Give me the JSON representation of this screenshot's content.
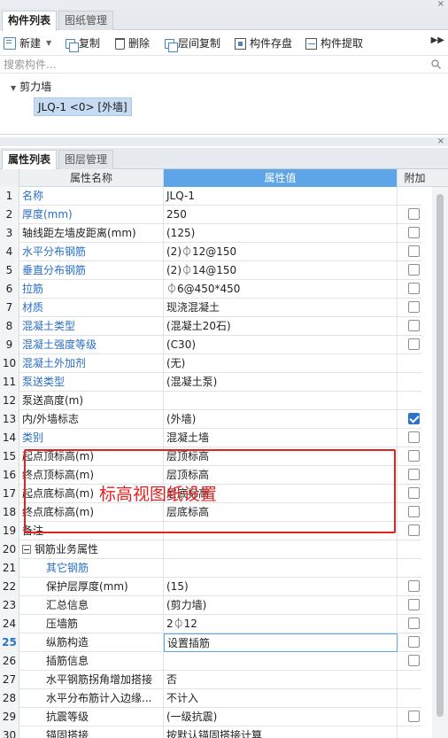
{
  "top_panel": {
    "tabs": [
      {
        "label": "构件列表",
        "active": true
      },
      {
        "label": "图纸管理",
        "active": false
      }
    ],
    "close_glyph": "×",
    "toolbar": {
      "new": "新建",
      "copy": "复制",
      "delete": "删除",
      "copy_floor": "层间复制",
      "store": "构件存盘",
      "extract": "构件提取"
    },
    "search": {
      "placeholder": "搜索构件...",
      "value": ""
    },
    "tree": {
      "group_label": "剪力墙",
      "items": [
        {
          "label": "JLQ-1 <0> [外墙]",
          "selected": true
        }
      ]
    }
  },
  "bottom_panel": {
    "tabs": [
      {
        "label": "属性列表",
        "active": true
      },
      {
        "label": "图层管理",
        "active": false
      }
    ],
    "close_glyph": "×",
    "columns": {
      "name": "属性名称",
      "value": "属性值",
      "extra": "附加"
    },
    "rows": [
      {
        "num": "1",
        "name": "名称",
        "value": "JLQ-1",
        "blue": true,
        "checkbox": false
      },
      {
        "num": "2",
        "name": "厚度(mm)",
        "value": "250",
        "blue": true,
        "checkbox": true,
        "checked": false
      },
      {
        "num": "3",
        "name": "轴线距左墙皮距离(mm)",
        "value": "(125)",
        "blue": false,
        "checkbox": true,
        "checked": false
      },
      {
        "num": "4",
        "name": "水平分布钢筋",
        "value": "(2)⏀12@150",
        "blue": true,
        "checkbox": true,
        "checked": false
      },
      {
        "num": "5",
        "name": "垂直分布钢筋",
        "value": "(2)⏀14@150",
        "blue": true,
        "checkbox": true,
        "checked": false
      },
      {
        "num": "6",
        "name": "拉筋",
        "value": "⏀6@450*450",
        "blue": true,
        "checkbox": true,
        "checked": false
      },
      {
        "num": "7",
        "name": "材质",
        "value": "现浇混凝土",
        "blue": true,
        "checkbox": true,
        "checked": false
      },
      {
        "num": "8",
        "name": "混凝土类型",
        "value": "(混凝土20石)",
        "blue": true,
        "checkbox": true,
        "checked": false
      },
      {
        "num": "9",
        "name": "混凝土强度等级",
        "value": "(C30)",
        "blue": true,
        "checkbox": true,
        "checked": false
      },
      {
        "num": "10",
        "name": "混凝土外加剂",
        "value": "(无)",
        "blue": true,
        "checkbox": false
      },
      {
        "num": "11",
        "name": "泵送类型",
        "value": "(混凝土泵)",
        "blue": true,
        "checkbox": false
      },
      {
        "num": "12",
        "name": "泵送高度(m)",
        "value": "",
        "blue": false,
        "checkbox": false
      },
      {
        "num": "13",
        "name": "内/外墙标志",
        "value": "(外墙)",
        "blue": false,
        "checkbox": true,
        "checked": true
      },
      {
        "num": "14",
        "name": "类别",
        "value": "混凝土墙",
        "blue": true,
        "checkbox": true,
        "checked": false
      },
      {
        "num": "15",
        "name": "起点顶标高(m)",
        "value": "层顶标高",
        "blue": false,
        "checkbox": true,
        "checked": false
      },
      {
        "num": "16",
        "name": "终点顶标高(m)",
        "value": "层顶标高",
        "blue": false,
        "checkbox": true,
        "checked": false
      },
      {
        "num": "17",
        "name": "起点底标高(m)",
        "value": "层底标高",
        "blue": false,
        "checkbox": true,
        "checked": false
      },
      {
        "num": "18",
        "name": "终点底标高(m)",
        "value": "层底标高",
        "blue": false,
        "checkbox": true,
        "checked": false
      },
      {
        "num": "19",
        "name": "备注",
        "value": "",
        "blue": false,
        "checkbox": true,
        "checked": false
      },
      {
        "num": "20",
        "name": "钢筋业务属性",
        "value": "",
        "blue": false,
        "checkbox": false,
        "group": true
      },
      {
        "num": "21",
        "name": "其它钢筋",
        "value": "",
        "blue": true,
        "checkbox": false,
        "indent": true
      },
      {
        "num": "22",
        "name": "保护层厚度(mm)",
        "value": "(15)",
        "blue": false,
        "checkbox": true,
        "checked": false,
        "indent": true
      },
      {
        "num": "23",
        "name": "汇总信息",
        "value": "(剪力墙)",
        "blue": false,
        "checkbox": true,
        "checked": false,
        "indent": true
      },
      {
        "num": "24",
        "name": "压墙筋",
        "value": "2⏀12",
        "blue": false,
        "checkbox": true,
        "checked": false,
        "indent": true
      },
      {
        "num": "25",
        "name": "纵筋构造",
        "value": "设置插筋",
        "blue": false,
        "checkbox": true,
        "checked": false,
        "indent": true,
        "current": true
      },
      {
        "num": "26",
        "name": "插筋信息",
        "value": "",
        "blue": false,
        "checkbox": true,
        "checked": false,
        "indent": true
      },
      {
        "num": "27",
        "name": "水平钢筋拐角增加搭接",
        "value": "否",
        "blue": false,
        "checkbox": false,
        "indent": true
      },
      {
        "num": "28",
        "name": "水平分布筋计入边缘...",
        "value": "不计入",
        "blue": false,
        "checkbox": false,
        "indent": true
      },
      {
        "num": "29",
        "name": "抗震等级",
        "value": "(一级抗震)",
        "blue": false,
        "checkbox": true,
        "checked": false,
        "indent": true
      },
      {
        "num": "30",
        "name": "锚固搭接",
        "value": "按默认锚固搭接计算",
        "blue": false,
        "checkbox": false,
        "indent": true
      }
    ]
  },
  "annotation": {
    "text": "标高视图纸设置",
    "color": "#e52222"
  },
  "colors": {
    "header_value_bg": "#5da4e8",
    "link_blue": "#2a6fc4",
    "checked": "#2a73c9"
  }
}
